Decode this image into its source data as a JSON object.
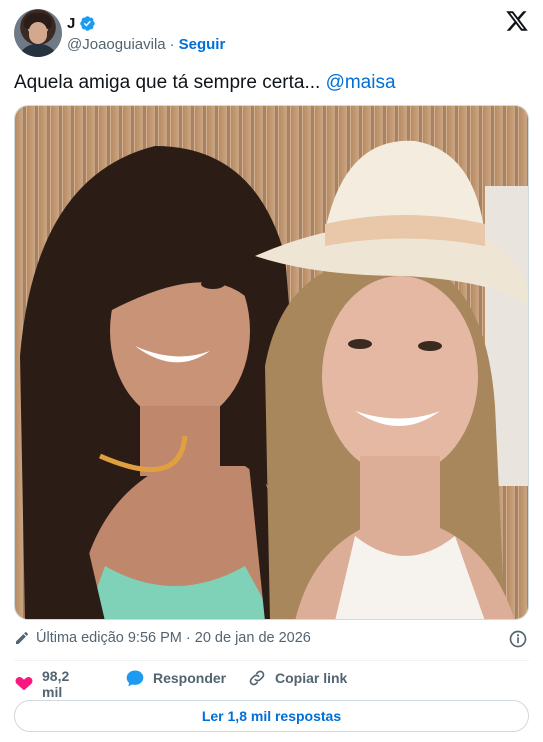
{
  "author": {
    "name": "J",
    "handle": "@Joaoguiavila",
    "separator": "·",
    "follow_label": "Seguir",
    "verified_icon": "verified-badge-icon",
    "avatar_icon": "avatar"
  },
  "platform_icon": "x-logo-icon",
  "tweet": {
    "text": "Aquela amiga que tá sempre certa... ",
    "mention": "@maisa"
  },
  "meta": {
    "edited_label": "Última edição 9:56 PM · 20 de jan de 2026",
    "edit_icon": "pencil-icon",
    "info_icon": "info-icon"
  },
  "actions": {
    "likes": "98,2 mil",
    "reply_label": "Responder",
    "copy_label": "Copiar link"
  },
  "read_replies_label": "Ler 1,8 mil respostas",
  "colors": {
    "accent": "#006fd6",
    "like": "#f91880",
    "reply": "#1d9bf0",
    "secondary_text": "#536471",
    "border": "#cfd9de"
  }
}
